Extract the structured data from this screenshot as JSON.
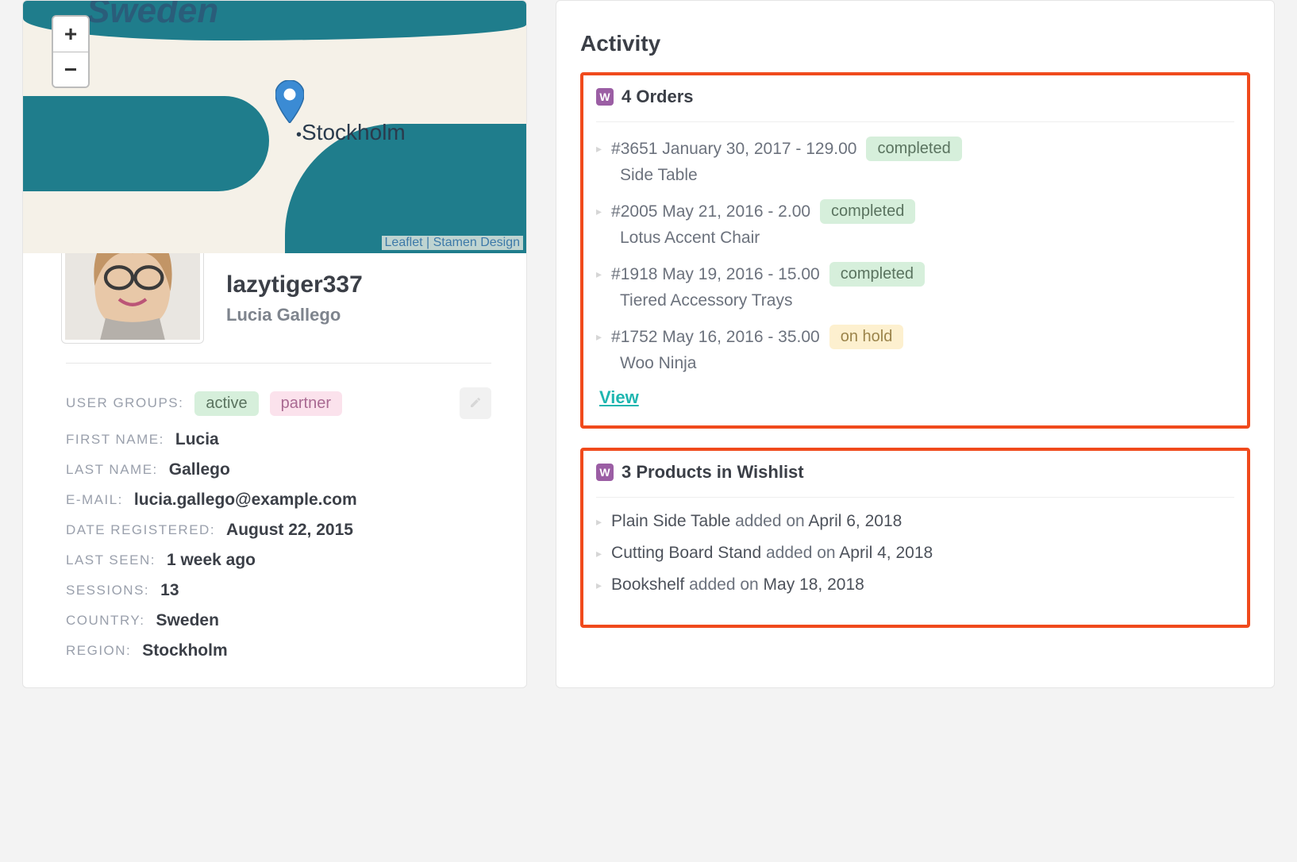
{
  "map": {
    "country_label": "Sweden",
    "city_label": "Stockholm",
    "zoom_in": "+",
    "zoom_out": "−",
    "attribution": "Leaflet | Stamen Design"
  },
  "profile": {
    "username": "lazytiger337",
    "full_name": "Lucia Gallego",
    "labels": {
      "user_groups": "USER GROUPS:",
      "first_name": "FIRST NAME:",
      "last_name": "LAST NAME:",
      "email": "E-MAIL:",
      "date_registered": "DATE REGISTERED:",
      "last_seen": "LAST SEEN:",
      "sessions": "SESSIONS:",
      "country": "COUNTRY:",
      "region": "REGION:"
    },
    "groups": [
      "active",
      "partner"
    ],
    "first_name": "Lucia",
    "last_name": "Gallego",
    "email": "lucia.gallego@example.com",
    "date_registered": "August 22, 2015",
    "last_seen": "1 week ago",
    "sessions": "13",
    "country": "Sweden",
    "region": "Stockholm"
  },
  "activity": {
    "title": "Activity",
    "orders": {
      "heading": "4 Orders",
      "view_link": "View",
      "items": [
        {
          "id": "#3651",
          "date": "January 30, 2017",
          "amount": "129.00",
          "status": "completed",
          "product": "Side Table"
        },
        {
          "id": "#2005",
          "date": "May 21, 2016",
          "amount": "2.00",
          "status": "completed",
          "product": "Lotus Accent Chair"
        },
        {
          "id": "#1918",
          "date": "May 19, 2016",
          "amount": "15.00",
          "status": "completed",
          "product": "Tiered Accessory Trays"
        },
        {
          "id": "#1752",
          "date": "May 16, 2016",
          "amount": "35.00",
          "status": "on hold",
          "product": "Woo Ninja"
        }
      ]
    },
    "wishlist": {
      "heading": "3 Products in Wishlist",
      "added_on": "added on",
      "items": [
        {
          "name": "Plain Side Table",
          "date": "April 6, 2018"
        },
        {
          "name": "Cutting Board Stand",
          "date": "April 4, 2018"
        },
        {
          "name": "Bookshelf",
          "date": "May 18, 2018"
        }
      ]
    }
  }
}
